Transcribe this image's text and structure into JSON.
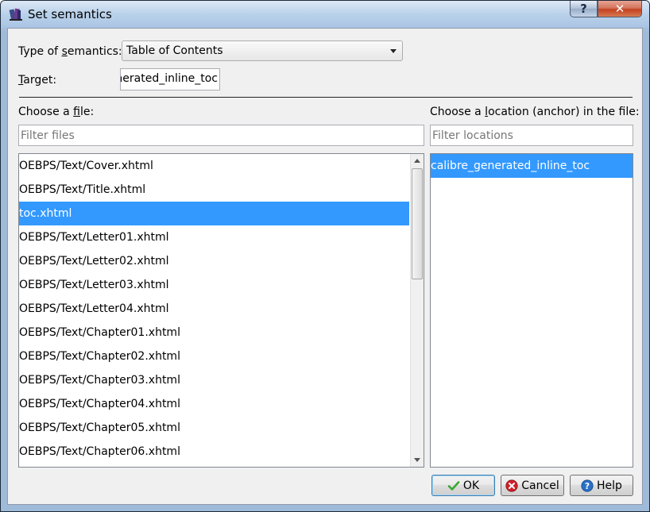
{
  "window": {
    "title": "Set semantics"
  },
  "form": {
    "type_label_pre": "Type of ",
    "type_label_ul": "s",
    "type_label_post": "emantics:",
    "type_value": "Table of Contents",
    "target_label_ul": "T",
    "target_label_post": "arget:",
    "target_value": "nerated_inline_toc"
  },
  "files": {
    "label_pre": "Choose a ",
    "label_ul": "f",
    "label_post": "ile:",
    "filter_placeholder": "Filter files",
    "items": [
      "OEBPS/Text/Cover.xhtml",
      "OEBPS/Text/Title.xhtml",
      "toc.xhtml",
      "OEBPS/Text/Letter01.xhtml",
      "OEBPS/Text/Letter02.xhtml",
      "OEBPS/Text/Letter03.xhtml",
      "OEBPS/Text/Letter04.xhtml",
      "OEBPS/Text/Chapter01.xhtml",
      "OEBPS/Text/Chapter02.xhtml",
      "OEBPS/Text/Chapter03.xhtml",
      "OEBPS/Text/Chapter04.xhtml",
      "OEBPS/Text/Chapter05.xhtml",
      "OEBPS/Text/Chapter06.xhtml"
    ],
    "selected_index": 2
  },
  "locations": {
    "label_pre": "Choose a ",
    "label_ul": "l",
    "label_post": "ocation (anchor) in the file:",
    "filter_placeholder": "Filter locations",
    "items": [
      "calibre_generated_inline_toc"
    ],
    "selected_index": 0
  },
  "buttons": {
    "ok": "OK",
    "cancel": "Cancel",
    "help": "Help"
  },
  "icons": {
    "app": "calibre-icon",
    "ok": "check-icon",
    "cancel": "cancel-icon",
    "help": "help-icon"
  },
  "colors": {
    "selection": "#3399ff",
    "ok_check": "#3aa832",
    "cancel_red": "#d0202a",
    "help_blue": "#2a6fc4"
  }
}
